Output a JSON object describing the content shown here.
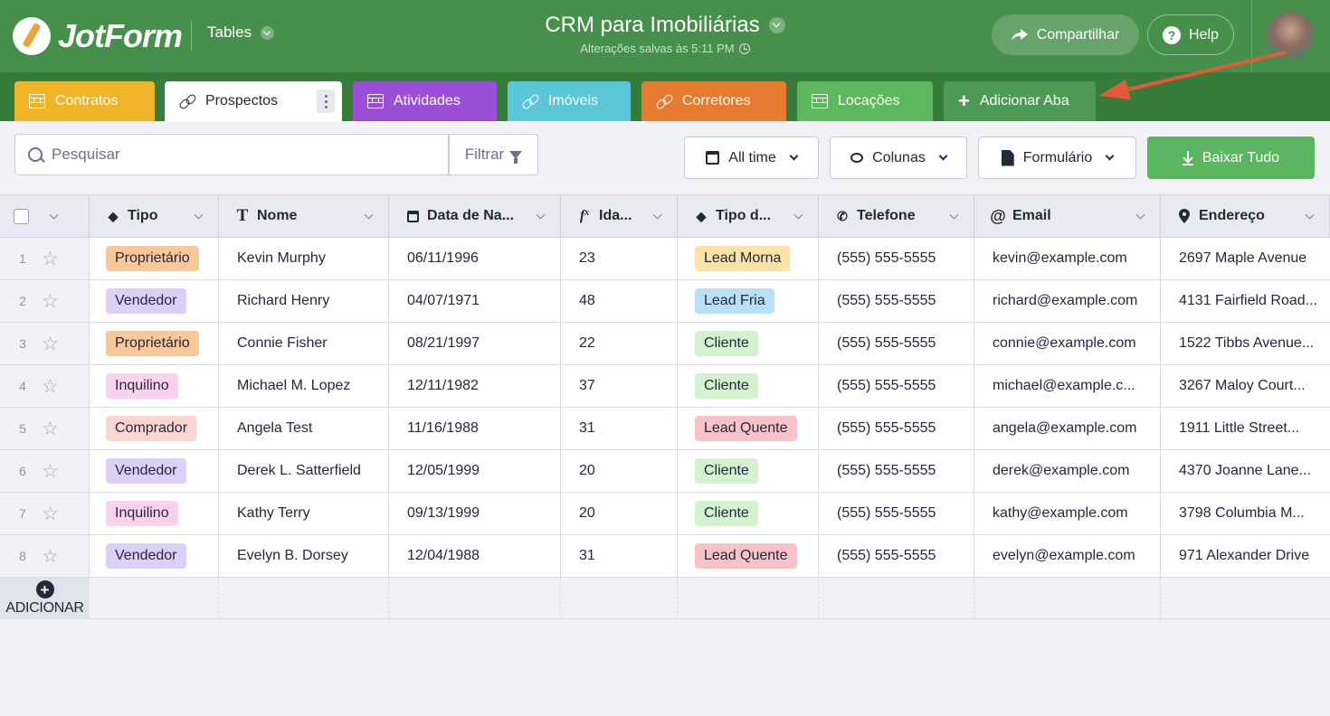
{
  "header": {
    "logo_text": "JotForm",
    "product_menu": "Tables",
    "title": "CRM para Imobiliárias",
    "save_status": "Alterações salvas às 5:11 PM",
    "share_label": "Compartilhar",
    "help_label": "Help"
  },
  "tabs": [
    {
      "label": "Contratos",
      "icon": "grid-icon",
      "color": "#f0b429",
      "active": false
    },
    {
      "label": "Prospectos",
      "icon": "link-icon",
      "color": "#ffffff",
      "active": true
    },
    {
      "label": "Atividades",
      "icon": "grid-icon",
      "color": "#9b4fd6",
      "active": false
    },
    {
      "label": "Imóveis",
      "icon": "link-icon",
      "color": "#5bc6d8",
      "active": false
    },
    {
      "label": "Corretores",
      "icon": "link-icon",
      "color": "#e67a2e",
      "active": false
    },
    {
      "label": "Locações",
      "icon": "grid-icon",
      "color": "#5cb85c",
      "active": false
    }
  ],
  "add_tab_label": "Adicionar Aba",
  "toolbar": {
    "search_placeholder": "Pesquisar",
    "filter_label": "Filtrar",
    "time_label": "All time",
    "columns_label": "Colunas",
    "form_label": "Formulário",
    "download_label": "Baixar Tudo"
  },
  "columns": [
    {
      "label": "Tipo",
      "icon": "tag-icon"
    },
    {
      "label": "Nome",
      "icon": "text-icon"
    },
    {
      "label": "Data de Na...",
      "icon": "calendar-icon"
    },
    {
      "label": "Ida...",
      "icon": "formula-icon"
    },
    {
      "label": "Tipo d...",
      "icon": "tag-icon"
    },
    {
      "label": "Telefone",
      "icon": "phone-icon"
    },
    {
      "label": "Email",
      "icon": "at-icon"
    },
    {
      "label": "Endereço",
      "icon": "location-icon"
    }
  ],
  "rows": [
    {
      "num": "1",
      "tipo": "Proprietário",
      "nome": "Kevin Murphy",
      "data": "06/11/1996",
      "idade": "23",
      "status": "Lead Morna",
      "telefone": "(555) 555-5555",
      "email": "kevin@example.com",
      "endereco": "2697 Maple Avenue"
    },
    {
      "num": "2",
      "tipo": "Vendedor",
      "nome": "Richard Henry",
      "data": "04/07/1971",
      "idade": "48",
      "status": "Lead Fria",
      "telefone": "(555) 555-5555",
      "email": "richard@example.com",
      "endereco": "4131 Fairfield Road..."
    },
    {
      "num": "3",
      "tipo": "Proprietário",
      "nome": "Connie Fisher",
      "data": "08/21/1997",
      "idade": "22",
      "status": "Cliente",
      "telefone": "(555) 555-5555",
      "email": "connie@example.com",
      "endereco": "1522 Tibbs Avenue..."
    },
    {
      "num": "4",
      "tipo": "Inquilino",
      "nome": "Michael M. Lopez",
      "data": "12/11/1982",
      "idade": "37",
      "status": "Cliente",
      "telefone": "(555) 555-5555",
      "email": "michael@example.c...",
      "endereco": "3267 Maloy Court..."
    },
    {
      "num": "5",
      "tipo": "Comprador",
      "nome": "Angela Test",
      "data": "11/16/1988",
      "idade": "31",
      "status": "Lead Quente",
      "telefone": "(555) 555-5555",
      "email": "angela@example.com",
      "endereco": "1911 Little Street..."
    },
    {
      "num": "6",
      "tipo": "Vendedor",
      "nome": "Derek L. Satterfield",
      "data": "12/05/1999",
      "idade": "20",
      "status": "Cliente",
      "telefone": "(555) 555-5555",
      "email": "derek@example.com",
      "endereco": "4370 Joanne Lane..."
    },
    {
      "num": "7",
      "tipo": "Inquilino",
      "nome": "Kathy Terry",
      "data": "09/13/1999",
      "idade": "20",
      "status": "Cliente",
      "telefone": "(555) 555-5555",
      "email": "kathy@example.com",
      "endereco": "3798 Columbia M..."
    },
    {
      "num": "8",
      "tipo": "Vendedor",
      "nome": "Evelyn B. Dorsey",
      "data": "12/04/1988",
      "idade": "31",
      "status": "Lead Quente",
      "telefone": "(555) 555-5555",
      "email": "evelyn@example.com",
      "endereco": "971 Alexander Drive"
    }
  ],
  "pill_colors": {
    "Proprietário": "#f9c89a",
    "Vendedor": "#dcd0fb",
    "Inquilino": "#fad2ef",
    "Comprador": "#fbd5d0",
    "Lead Morna": "#fbe3a8",
    "Lead Fria": "#b9e0f7",
    "Cliente": "#d3f2cf",
    "Lead Quente": "#f7c3c9"
  },
  "add_row_label": "ADICIONAR"
}
